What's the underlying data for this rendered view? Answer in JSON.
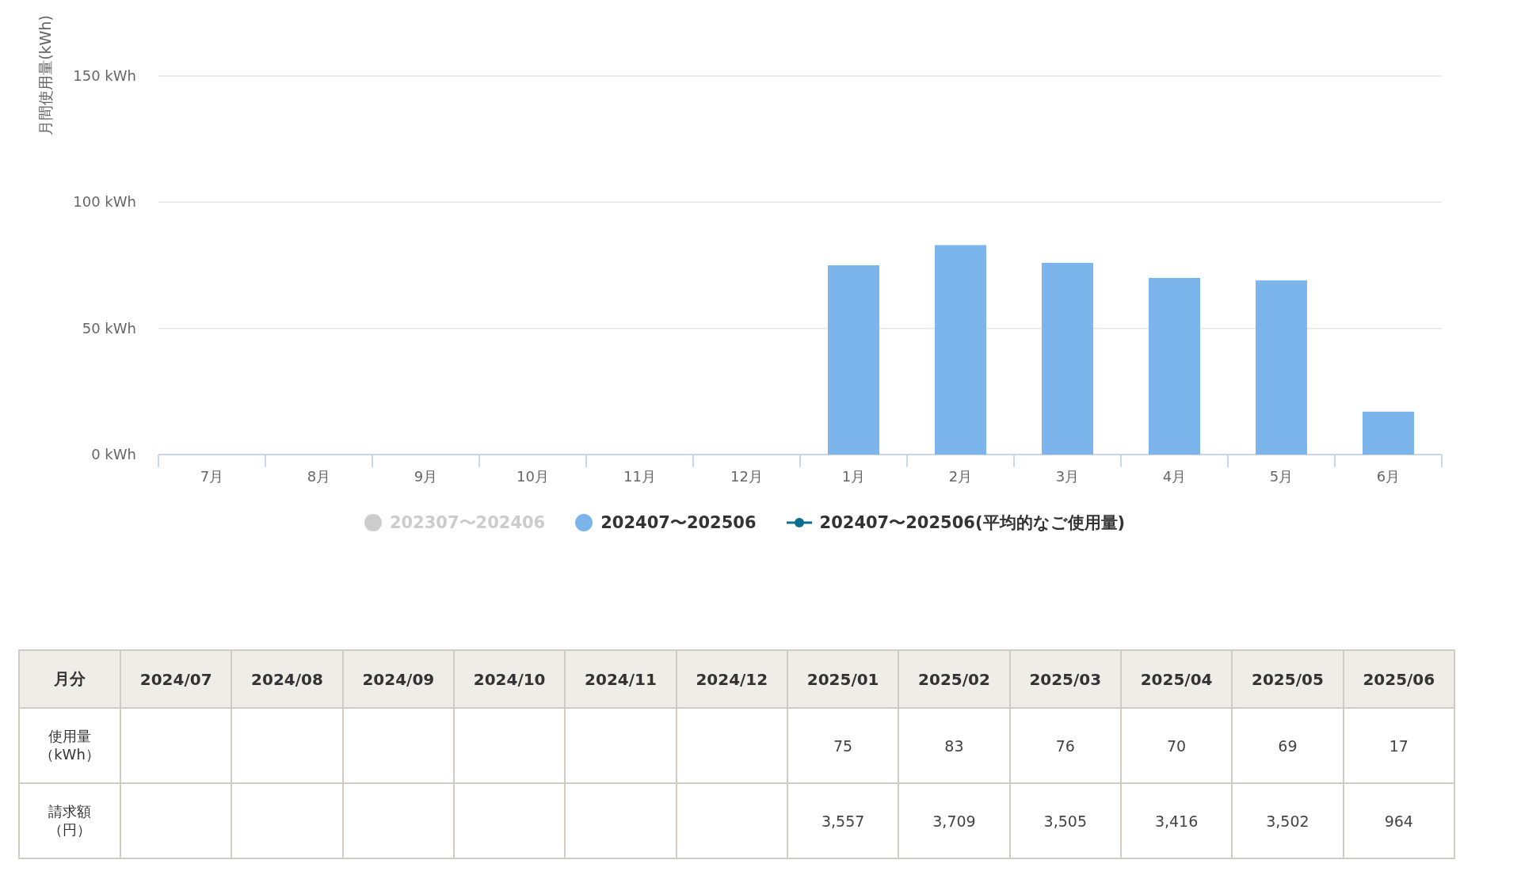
{
  "chart": {
    "chart_data": {
      "type": "bar",
      "ylabel": "月間使用量(kWh)",
      "categories": [
        "7月",
        "8月",
        "9月",
        "10月",
        "11月",
        "12月",
        "1月",
        "2月",
        "3月",
        "4月",
        "5月",
        "6月"
      ],
      "series": [
        {
          "name": "202307〜202406",
          "color": "#cccccc",
          "values": [
            null,
            null,
            null,
            null,
            null,
            null,
            null,
            null,
            null,
            null,
            null,
            null
          ]
        },
        {
          "name": "202407〜202506",
          "color": "#7cb5ec",
          "values": [
            null,
            null,
            null,
            null,
            null,
            null,
            75,
            83,
            76,
            70,
            69,
            17
          ]
        },
        {
          "name": "202407〜202506(平均的なご使用量)",
          "color": "#0b6e8e",
          "values": [
            null,
            null,
            null,
            null,
            null,
            null,
            null,
            null,
            null,
            null,
            null,
            null
          ]
        }
      ],
      "ylim": [
        0,
        150
      ],
      "yticks": [
        {
          "value": 0,
          "label": "0 kWh"
        },
        {
          "value": 50,
          "label": "50 kWh"
        },
        {
          "value": 100,
          "label": "100 kWh"
        },
        {
          "value": 150,
          "label": "150 kWh"
        }
      ]
    },
    "legend": [
      {
        "kind": "dot",
        "on": false
      },
      {
        "kind": "dot",
        "on": true
      },
      {
        "kind": "line",
        "on": true
      }
    ]
  },
  "table": {
    "corner": "月分",
    "columns": [
      "2024/07",
      "2024/08",
      "2024/09",
      "2024/10",
      "2024/11",
      "2024/12",
      "2025/01",
      "2025/02",
      "2025/03",
      "2025/04",
      "2025/05",
      "2025/06"
    ],
    "rows": [
      {
        "label_lines": [
          "使用量",
          "（kWh）"
        ],
        "cells": [
          null,
          null,
          null,
          null,
          null,
          null,
          "75",
          "83",
          "76",
          "70",
          "69",
          "17"
        ]
      },
      {
        "label_lines": [
          "請求額",
          "（円）"
        ],
        "cells": [
          null,
          null,
          null,
          null,
          null,
          null,
          "3,557",
          "3,709",
          "3,505",
          "3,416",
          "3,502",
          "964"
        ]
      }
    ]
  }
}
